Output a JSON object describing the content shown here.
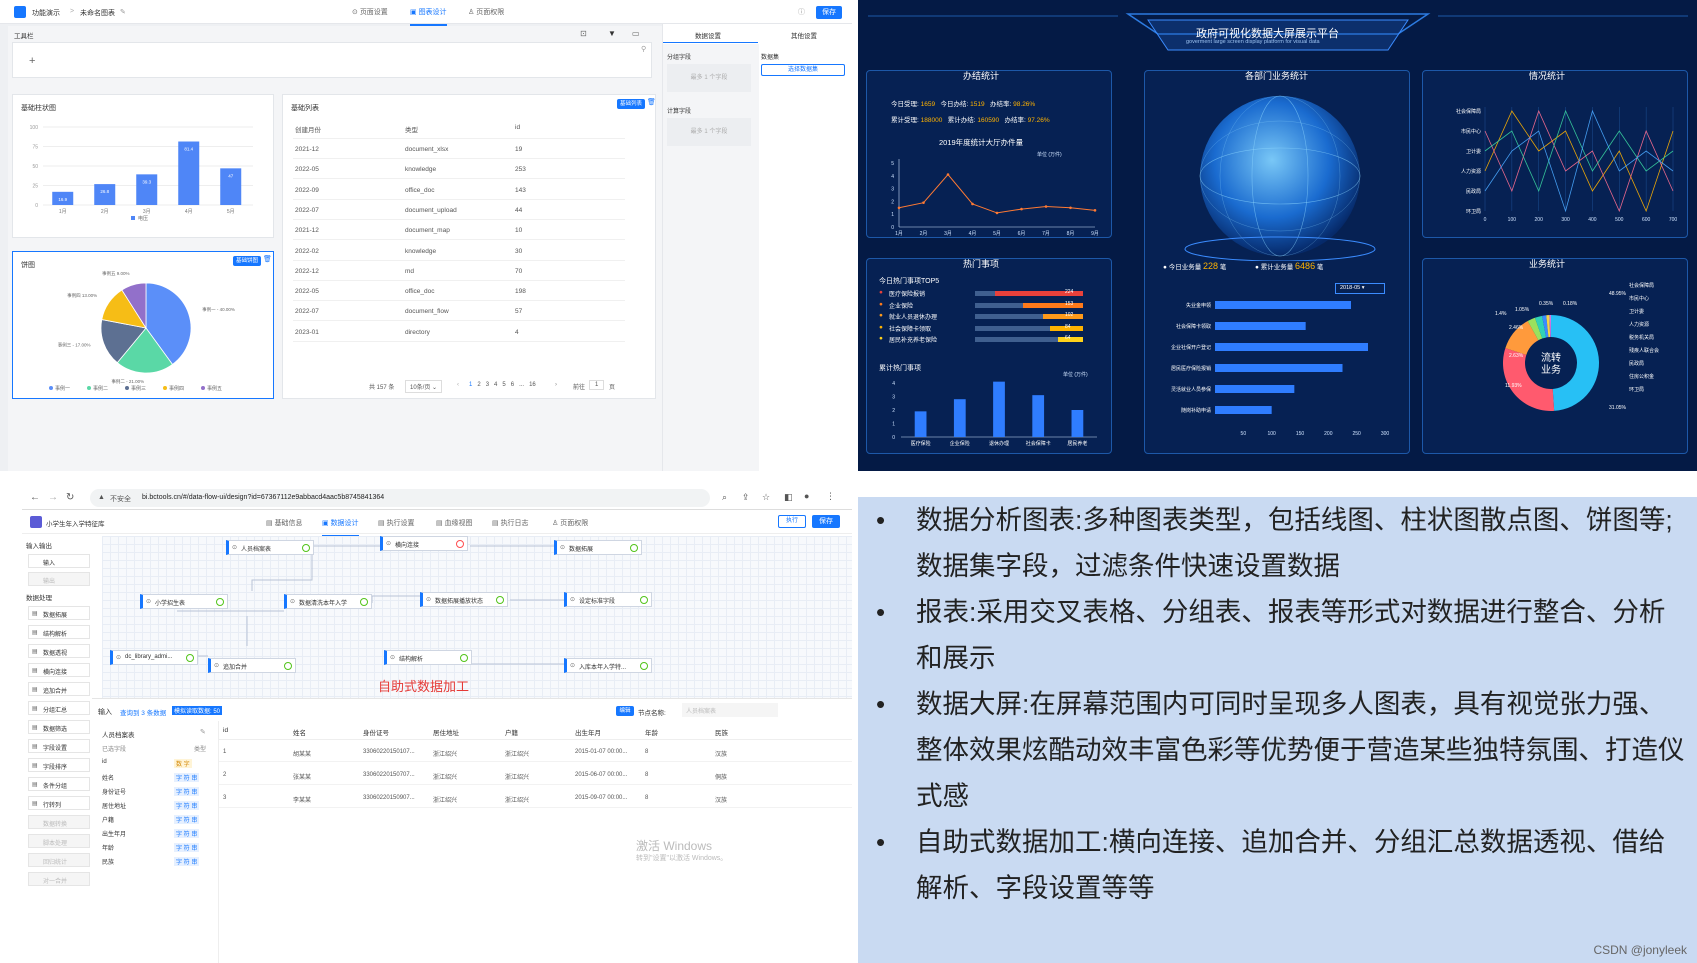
{
  "chart_design": {
    "breadcrumb_app": "功能演示",
    "breadcrumb_page": "未命名图表",
    "tabs": [
      "页面设置",
      "图表设计",
      "页面权限"
    ],
    "save": "保存",
    "toolbar_label": "工具栏",
    "add": "+",
    "right_tabs": [
      "数据设置",
      "其他设置"
    ],
    "group_field": "分组字段",
    "calc_field": "计算字段",
    "dataset_label": "数据集",
    "select_dataset": "选择数据集",
    "drop_hint": "最多 1 个字段",
    "bar_title": "基础柱状图",
    "pie_title": "饼图",
    "pie_badge": "基础饼图",
    "table_title": "基础列表",
    "table_badge": "基础列表",
    "table_headers": [
      "创建月份",
      "类型",
      "id"
    ],
    "table_rows": [
      [
        "2021-12",
        "document_xlsx",
        "19"
      ],
      [
        "2022-05",
        "knowledge",
        "253"
      ],
      [
        "2022-09",
        "office_doc",
        "143"
      ],
      [
        "2022-07",
        "document_upload",
        "44"
      ],
      [
        "2021-12",
        "document_map",
        "10"
      ],
      [
        "2022-02",
        "knowledge",
        "30"
      ],
      [
        "2022-12",
        "md",
        "70"
      ],
      [
        "2022-05",
        "office_doc",
        "198"
      ],
      [
        "2022-07",
        "document_flow",
        "57"
      ],
      [
        "2023-01",
        "directory",
        "4"
      ]
    ],
    "pager_total": "共 157 条",
    "pager_size": "10条/页",
    "pager_pages": [
      "1",
      "2",
      "3",
      "4",
      "5",
      "6",
      "...",
      "16"
    ],
    "pager_goto": "前往",
    "pager_input": "1",
    "pager_unit": "页"
  },
  "chart_data": [
    {
      "type": "bar",
      "title": "基础柱状图",
      "categories": [
        "1月",
        "2月",
        "3月",
        "4月",
        "5月"
      ],
      "series": [
        {
          "name": "电压",
          "values": [
            16.9,
            26.8,
            39.3,
            81.4,
            47
          ]
        }
      ],
      "yticks": [
        0,
        25,
        50,
        75,
        100
      ],
      "ylim": [
        0,
        100
      ]
    },
    {
      "type": "pie",
      "title": "饼图",
      "categories": [
        "事例一",
        "事例二",
        "事例三",
        "事例四",
        "事例五"
      ],
      "values": [
        40,
        21,
        17,
        13,
        9
      ],
      "labels": [
        "事例一 - 40.00%",
        "事例二 - 21.00%",
        "事例三 - 17.00%",
        "事例四 13.00%",
        "事例五 9.00%"
      ],
      "colors": [
        "#5b8ff9",
        "#5ad8a6",
        "#5d7092",
        "#f6bd16",
        "#9270ca"
      ],
      "legend": "bottom"
    },
    {
      "type": "line",
      "title": "2019年度统计大厅办件量",
      "unit": "单位 (万件)",
      "categories": [
        "1月",
        "2月",
        "3月",
        "4月",
        "5月",
        "6月",
        "7月",
        "8月",
        "9月"
      ],
      "values": [
        1.5,
        1.9,
        4.1,
        1.8,
        1.1,
        1.4,
        1.6,
        1.5,
        1.3
      ],
      "yticks": [
        0,
        1,
        2,
        3,
        4,
        5
      ],
      "ylim": [
        0,
        5
      ]
    },
    {
      "type": "bar",
      "title": "累计热门事项",
      "unit": "单位 (万件)",
      "categories": [
        "医疗保险",
        "企业保险",
        "退休办理",
        "社会保障卡",
        "居民养老"
      ],
      "values": [
        1.9,
        2.8,
        4.1,
        3.1,
        2.0
      ],
      "yticks": [
        0,
        1,
        2,
        3,
        4
      ],
      "ylim": [
        0,
        4
      ]
    },
    {
      "type": "bar",
      "title": "各部门业务统计",
      "orientation": "horizontal",
      "categories": [
        "失业金申领",
        "社会保障卡领取",
        "企业社保开户登记",
        "居民医疗保险报销",
        "灵活就业人员参保",
        "随岗补助申请"
      ],
      "values": [
        240,
        160,
        270,
        225,
        140,
        100
      ],
      "xticks": [
        50,
        100,
        150,
        200,
        250,
        300
      ]
    },
    {
      "type": "line",
      "title": "情况统计",
      "categories": [
        "社会保障局",
        "市民中心",
        "卫计委",
        "人力资源",
        "民政局",
        "环卫局"
      ],
      "xticks": [
        0,
        100,
        200,
        300,
        400,
        500,
        600,
        700
      ]
    },
    {
      "type": "pie",
      "title": "业务统计",
      "categories": [
        "社会保障局",
        "市民中心",
        "卫计委",
        "人力资源",
        "税务机关局",
        "残疾人联合会",
        "民政局",
        "住房公积金",
        "环卫局"
      ],
      "values": [
        48.95,
        31.05,
        11.93,
        2.63,
        2.46,
        1.4,
        1.05,
        0.35,
        0.18
      ],
      "labels": [
        "48.95%",
        "31.05%",
        "11.93%",
        "2.63%",
        "2.46%",
        "1.4%",
        "1.05%",
        "0.35%",
        "0.18%"
      ],
      "center_text": [
        "流转",
        "业务"
      ]
    }
  ],
  "dashboard": {
    "title": "政府可视化数据大屏展示平台",
    "subtitle": "goverment large screen display platform for visual data",
    "panel_titles": [
      "办结统计",
      "各部门业务统计",
      "情况统计",
      "热门事项",
      "业务统计"
    ],
    "stat1": {
      "a_label": "今日受理:",
      "a_val": "1659",
      "b_label": "今日办结:",
      "b_val": "1519",
      "c_label": "办结率:",
      "c_val": "98.26%"
    },
    "stat2": {
      "a_label": "累计受理:",
      "a_val": "188000",
      "b_label": "累计办结:",
      "b_val": "160590",
      "c_label": "办结率:",
      "c_val": "97.26%"
    },
    "line_title": "2019年度统计大厅办件量",
    "unit": "单位 (万件)",
    "top5_title": "今日热门事项TOP5",
    "top5": [
      {
        "name": "医疗保险报销",
        "val": "224",
        "color": "#e8413b"
      },
      {
        "name": "企业保险",
        "val": "153",
        "color": "#ff7a1a"
      },
      {
        "name": "就业人员退休办理",
        "val": "102",
        "color": "#ff9a1a"
      },
      {
        "name": "社会保障卡领取",
        "val": "84",
        "color": "#ffb300"
      },
      {
        "name": "居民补充养老保险",
        "val": "64",
        "color": "#ffd21a"
      }
    ],
    "cum_title": "累计热门事项",
    "today_biz_label": "今日业务量",
    "today_biz_val": "228",
    "biz_unit": "笔",
    "cum_biz_label": "累计业务量",
    "cum_biz_val": "6486",
    "date_select": "2018-05"
  },
  "dataflow": {
    "url_warning": "不安全",
    "url": "bi.bctools.cn/#/data-flow-ui/design?id=67367112e9abbacd4aac5b8745841364",
    "app_title": "小学生年入学特征库",
    "tabs": [
      "基础信息",
      "数据设计",
      "执行设置",
      "血缘视图",
      "执行日志",
      "页面权限"
    ],
    "run": "执行",
    "save": "保存",
    "left_groups": [
      "输入输出",
      "数据处理"
    ],
    "left_io": [
      "输入",
      "输出"
    ],
    "left_nodes": [
      "数据拓展",
      "结构解析",
      "数据透视",
      "横向连接",
      "追加合并",
      "分组汇总",
      "数据筛选",
      "字段设置",
      "字段排序",
      "条件分组",
      "行转列"
    ],
    "left_disabled": [
      "数据转换",
      "脚本处理",
      "回归统计",
      "对一合并"
    ],
    "nodes": [
      "人员档案表",
      "横向连接",
      "数据拓展",
      "小学招生表",
      "数据清洗本年入学",
      "数据拓展播放状态",
      "设定标准字段",
      "dc_library_admi...",
      "追加合并",
      "结构解析",
      "入库本年入学特..."
    ],
    "caption": "自助式数据加工",
    "bottom_tab": "输入",
    "query_result": "查询到 3 条数据",
    "sim_data": "模拟读取数据: 50",
    "edit_btn": "编辑",
    "node_name_label": "节点名称:",
    "node_name_val": "人员档案表",
    "source_name": "人员档案表",
    "selected_fields": "已选字段",
    "type_label": "类型",
    "fields": [
      [
        "id",
        "数 字"
      ],
      [
        "姓名",
        "字 符 串"
      ],
      [
        "身份证号",
        "字 符 串"
      ],
      [
        "居住地址",
        "字 符 串"
      ],
      [
        "户籍",
        "字 符 串"
      ],
      [
        "出生年月",
        "字 符 串"
      ],
      [
        "年龄",
        "字 符 串"
      ],
      [
        "民族",
        "字 符 串"
      ]
    ],
    "grid_headers": [
      "id",
      "姓名",
      "身份证号",
      "居住地址",
      "户籍",
      "出生年月",
      "年龄",
      "民族"
    ],
    "grid_rows": [
      [
        "1",
        "胡某某",
        "33060220150107...",
        "浙江绍兴",
        "浙江绍兴",
        "2015-01-07 00:00...",
        "8",
        "汉族"
      ],
      [
        "2",
        "张某某",
        "33060220150707...",
        "浙江绍兴",
        "浙江绍兴",
        "2015-06-07 00:00...",
        "8",
        "侗族"
      ],
      [
        "3",
        "李某某",
        "33060220150907...",
        "浙江绍兴",
        "浙江绍兴",
        "2015-09-07 00:00...",
        "8",
        "汉族"
      ]
    ],
    "watermark1": "激活 Windows",
    "watermark2": "转到\"设置\"以激活 Windows。"
  },
  "description": {
    "bullets": [
      "数据分析图表:多种图表类型，包括线图、柱状图散点图、饼图等;数据集字段，过滤条件快速设置数据",
      "报表:采用交叉表格、分组表、报表等形式对数据进行整合、分析和展示",
      "数据大屏:在屏幕范围内可同时呈现多人图表，具有视觉张力强、整体效果炫酷动效丰富色彩等优势便于营造某些独特氛围、打造仪式感",
      "自助式数据加工:横向连接、追加合并、分组汇总数据透视、借给解析、字段设置等等"
    ],
    "credit": "CSDN @jonyleek"
  }
}
